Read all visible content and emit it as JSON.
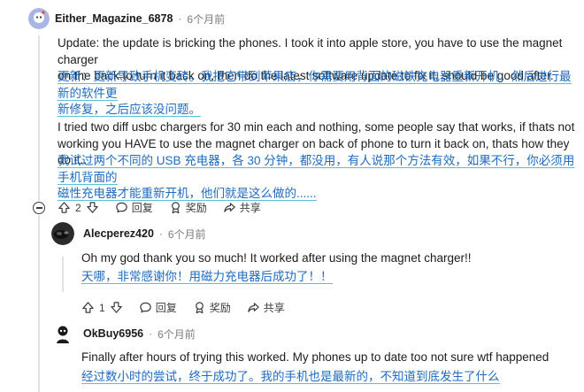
{
  "comments": [
    {
      "author": "Either_Magazine_6878",
      "separator": "·",
      "time": "6个月前",
      "en": [
        "Update: the update is bricking the phones. I took it into apple store, you have to use the magnet charger",
        "on the back to turn it back on, then do the latest software update to fix it, should be good after."
      ],
      "zh": [
        "更新：更新导致手机变砖。我把它带到苹果店，你需要用背面的磁铁充电器重新开机，然后进行最新的软件更",
        "新修复，之后应该没问题。"
      ],
      "en2": [
        "I tried two diff usbc chargers for 30 min each and nothing, some people say that works, if thats not",
        "working you HAVE to use the magnet charger on back of phone to turn it back on, thats how they do it.."
      ],
      "zh2": [
        "我试过两个不同的 USB 充电器，各 30 分钟，都没用，有人说那个方法有效，如果不行，你必须用手机背面的",
        "磁性充电器才能重新开机，他们就是这么做的......"
      ],
      "votes": "2",
      "reply": "回复",
      "award": "奖励",
      "share": "共享"
    },
    {
      "author": "Alecperez420",
      "separator": "·",
      "time": "6个月前",
      "en": [
        "Oh my god thank you so much! It worked after using the magnet charger!!"
      ],
      "zh": [
        "天哪，非常感谢你！用磁力充电器后成功了！！"
      ],
      "votes": "1",
      "reply": "回复",
      "award": "奖励",
      "share": "共享"
    },
    {
      "author": "OkBuy6956",
      "separator": "·",
      "time": "6个月前",
      "en": [
        "Finally after hours of trying this worked. My phones up to date too not sure wtf happened"
      ],
      "zh": [
        "经过数小时的尝试，终于成功了。我的手机也是最新的，不知道到底发生了什么"
      ]
    }
  ],
  "icons": {
    "upvote": "arrow-up-icon",
    "downvote": "arrow-down-icon",
    "reply": "speech-bubble-icon",
    "award": "award-icon",
    "share": "share-arrow-icon",
    "collapse": "minus-circle-icon"
  },
  "colors": {
    "translation_text": "#1e6bbf",
    "translation_underline": "#5bc0d8",
    "thread_line": "#e0e3e6"
  }
}
